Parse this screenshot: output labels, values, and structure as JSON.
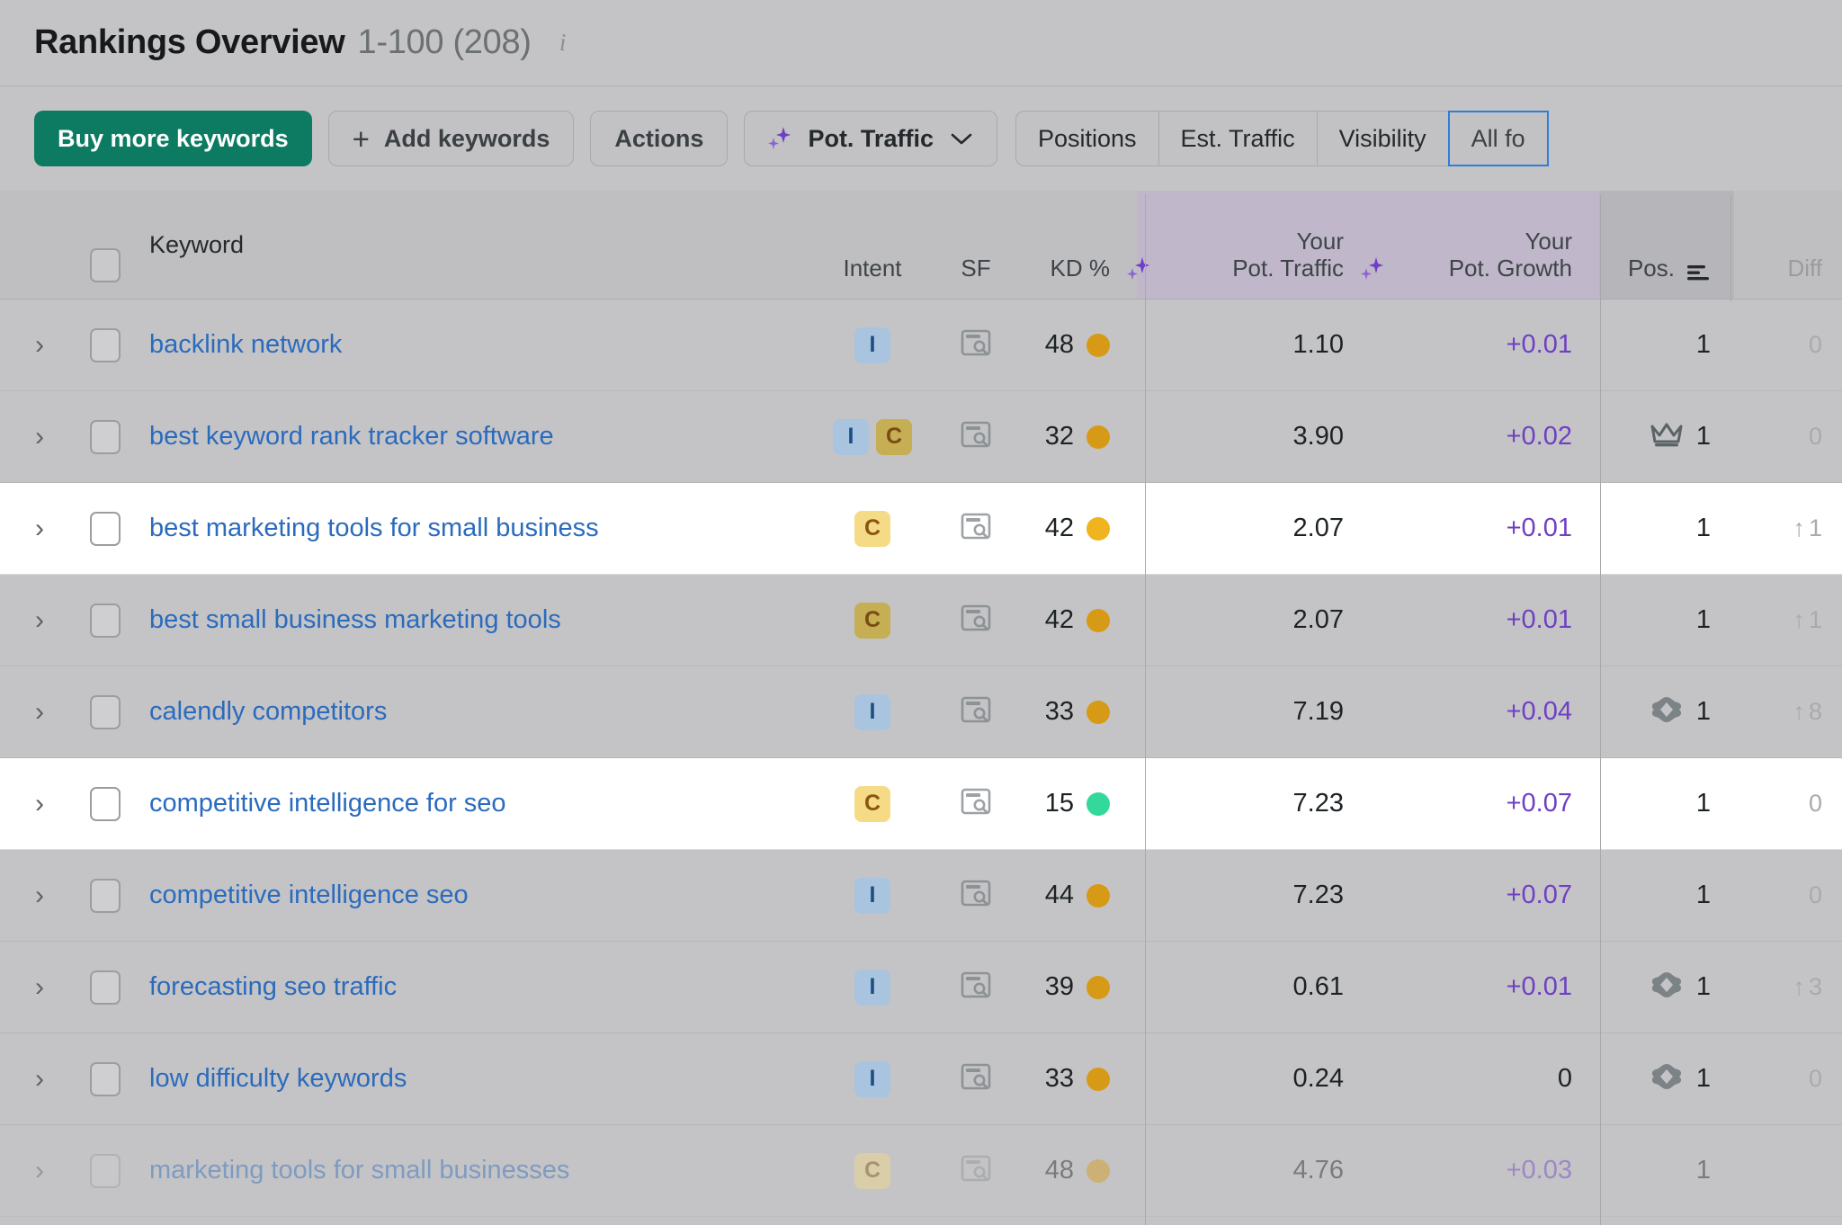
{
  "header": {
    "title": "Rankings Overview",
    "range": "1-100 (208)",
    "info_icon": "info-icon"
  },
  "toolbar": {
    "buy_more_keywords": "Buy more keywords",
    "add_keywords": "Add keywords",
    "add_keywords_plus": "+",
    "actions": "Actions",
    "pot_traffic": "Pot. Traffic",
    "segments": [
      {
        "label": "Positions",
        "active": false
      },
      {
        "label": "Est. Traffic",
        "active": false
      },
      {
        "label": "Visibility",
        "active": false
      },
      {
        "label": "All fo",
        "active": true
      }
    ]
  },
  "table": {
    "columns": {
      "keyword": "Keyword",
      "intent": "Intent",
      "sf": "SF",
      "kd": "KD %",
      "pot_traffic_line1": "Your",
      "pot_traffic_line2": "Pot. Traffic",
      "pot_growth_line1": "Your",
      "pot_growth_line2": "Pot. Growth",
      "pos": "Pos.",
      "diff": "Diff"
    },
    "colors": {
      "accent_green": "#0d7b62",
      "link_blue": "#2b6bbd",
      "growth_purple": "#6f3fc4",
      "kd_orange": "#d79a16",
      "kd_yellow": "#f0b41f",
      "kd_green": "#33d99b",
      "highlight_purple_bg": "#c0b7ca",
      "active_tab_border": "#2f7ed8"
    },
    "rows": [
      {
        "keyword": "backlink network",
        "intents": [
          "I"
        ],
        "intent_styles": [
          "I"
        ],
        "kd": "48",
        "kd_color": "#d79a16",
        "pot_traffic": "1.10",
        "pot_growth": "+0.01",
        "pos": "1",
        "pos_icon": "none",
        "diff": "0",
        "diff_arrow": "",
        "bg": "shade"
      },
      {
        "keyword": "best keyword rank tracker software",
        "intents": [
          "I",
          "C"
        ],
        "intent_styles": [
          "I",
          "C"
        ],
        "kd": "32",
        "kd_color": "#d79a16",
        "pot_traffic": "3.90",
        "pot_growth": "+0.02",
        "pos": "1",
        "pos_icon": "crown-icon",
        "diff": "0",
        "diff_arrow": "",
        "bg": "shade"
      },
      {
        "keyword": "best marketing tools for small business",
        "intents": [
          "C"
        ],
        "intent_styles": [
          "C-light"
        ],
        "kd": "42",
        "kd_color": "#f0b41f",
        "pot_traffic": "2.07",
        "pot_growth": "+0.01",
        "pos": "1",
        "pos_icon": "none",
        "diff": "1",
        "diff_arrow": "↑",
        "bg": "white"
      },
      {
        "keyword": "best small business marketing tools",
        "intents": [
          "C"
        ],
        "intent_styles": [
          "C"
        ],
        "kd": "42",
        "kd_color": "#d79a16",
        "pot_traffic": "2.07",
        "pot_growth": "+0.01",
        "pos": "1",
        "pos_icon": "none",
        "diff": "1",
        "diff_arrow": "↑",
        "bg": "shade"
      },
      {
        "keyword": "calendly competitors",
        "intents": [
          "I"
        ],
        "intent_styles": [
          "I"
        ],
        "kd": "33",
        "kd_color": "#d79a16",
        "pot_traffic": "7.19",
        "pot_growth": "+0.04",
        "pos": "1",
        "pos_icon": "feature-badge-icon",
        "diff": "8",
        "diff_arrow": "↑",
        "bg": "shade"
      },
      {
        "keyword": "competitive intelligence for seo",
        "intents": [
          "C"
        ],
        "intent_styles": [
          "C-light"
        ],
        "kd": "15",
        "kd_color": "#33d99b",
        "pot_traffic": "7.23",
        "pot_growth": "+0.07",
        "pos": "1",
        "pos_icon": "none",
        "diff": "0",
        "diff_arrow": "",
        "bg": "white"
      },
      {
        "keyword": "competitive intelligence seo",
        "intents": [
          "I"
        ],
        "intent_styles": [
          "I"
        ],
        "kd": "44",
        "kd_color": "#d79a16",
        "pot_traffic": "7.23",
        "pot_growth": "+0.07",
        "pos": "1",
        "pos_icon": "none",
        "diff": "0",
        "diff_arrow": "",
        "bg": "shade"
      },
      {
        "keyword": "forecasting seo traffic",
        "intents": [
          "I"
        ],
        "intent_styles": [
          "I"
        ],
        "kd": "39",
        "kd_color": "#d79a16",
        "pot_traffic": "0.61",
        "pot_growth": "+0.01",
        "pos": "1",
        "pos_icon": "feature-badge-icon",
        "diff": "3",
        "diff_arrow": "↑",
        "bg": "shade"
      },
      {
        "keyword": "low difficulty keywords",
        "intents": [
          "I"
        ],
        "intent_styles": [
          "I"
        ],
        "kd": "33",
        "kd_color": "#d79a16",
        "pot_traffic": "0.24",
        "pot_growth": "0",
        "pot_growth_zero": true,
        "pos": "1",
        "pos_icon": "feature-badge-icon",
        "diff": "0",
        "diff_arrow": "",
        "bg": "shade"
      },
      {
        "keyword": "marketing tools for small businesses",
        "intents": [
          "C"
        ],
        "intent_styles": [
          "C-light"
        ],
        "kd": "48",
        "kd_color": "#d79a16",
        "pot_traffic": "4.76",
        "pot_growth": "+0.03",
        "pos": "1",
        "pos_icon": "none",
        "diff": "",
        "diff_arrow": "",
        "bg": "shade",
        "faded": true
      }
    ]
  }
}
